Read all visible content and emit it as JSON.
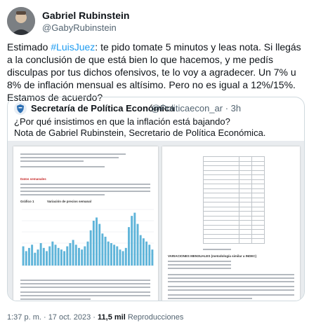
{
  "author": {
    "name": "Gabriel Rubinstein",
    "handle": "@GabyRubinstein"
  },
  "tweet": {
    "text_before": "Estimado ",
    "hashtag": "#LuisJuez",
    "text_after": ": te pido tomate 5 minutos y leas nota. Si llegás a la conclusión de que está bien lo que hacemos, y me pedís disculpas por tus dichos ofensivos, te lo voy a agradecer. Un 7% u 8% de inflación mensual es altísimo. Pero no es igual a 12%/15%. Estamos de acuerdo?"
  },
  "quote": {
    "account_name": "Secretaría de Política Económica",
    "handle_time": "@Politicaecon_ar · 3h",
    "line1": "¿Por qué insistimos en que la inflación está bajando?",
    "line2": "Nota de Gabriel Rubinstein, Secretario de Política Económica.",
    "doc": {
      "section_label": "Datos semanales",
      "chart_label": "Gráfico 1",
      "chart_title": "Variación de precios semanal",
      "page2_heading": "VARIACIONES MENSUALES (metodología similar a INDEC)",
      "chart_data": {
        "type": "bar",
        "values": [
          1.2,
          0.9,
          1.1,
          1.3,
          0.8,
          1.0,
          1.4,
          1.1,
          0.9,
          1.2,
          1.5,
          1.3,
          1.1,
          1.0,
          0.9,
          1.2,
          1.4,
          1.6,
          1.3,
          1.1,
          1.0,
          1.2,
          1.5,
          2.2,
          2.8,
          3.0,
          2.6,
          2.0,
          1.8,
          1.5,
          1.4,
          1.3,
          1.2,
          1.0,
          0.9,
          1.1,
          2.4,
          3.1,
          3.3,
          2.6,
          1.9,
          1.7,
          1.5,
          1.3,
          1.0
        ]
      }
    }
  },
  "footer": {
    "time": "1:37 p. m. · 17 oct. 2023 · ",
    "views_count": "11,5 mil",
    "views_label": " Reproducciones"
  },
  "colors": {
    "text": "#0f1419",
    "secondary": "#536471",
    "link": "#1d9bf0",
    "border": "#cfd9de",
    "bar": "#5fb4d9"
  }
}
